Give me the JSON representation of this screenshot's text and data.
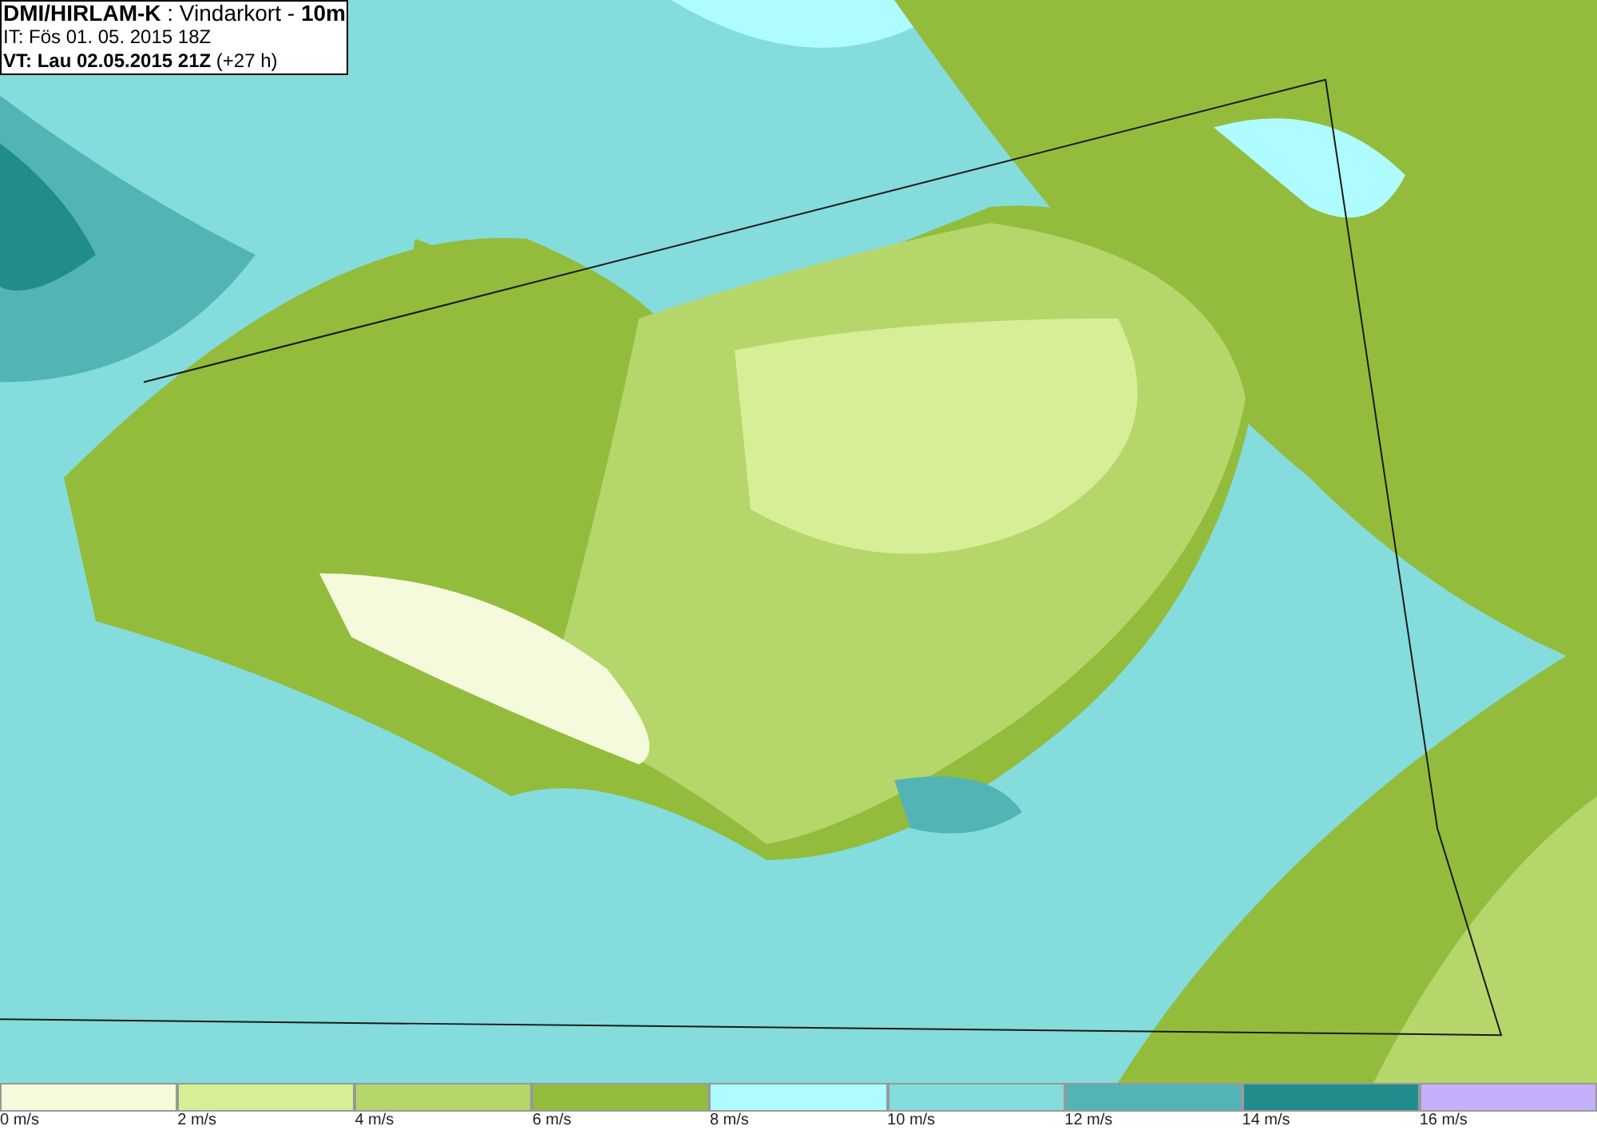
{
  "header": {
    "lines": [
      "**DMI/HIRLAM-K** : Vindarkort - **10m**",
      "IT: Fös 01. 05. 2015 18Z",
      "**VT: Lau 02.05.2015 21Z** (+27 h)"
    ]
  },
  "legend": {
    "bins": [
      {
        "label": "0 m/s",
        "color": "#f5fadc"
      },
      {
        "label": "2 m/s",
        "color": "#d6ef96"
      },
      {
        "label": "4 m/s",
        "color": "#b5d66a"
      },
      {
        "label": "6 m/s",
        "color": "#93bc3c"
      },
      {
        "label": "8 m/s",
        "color": "#aefcff"
      },
      {
        "label": "10 m/s",
        "color": "#84dcdc"
      },
      {
        "label": "12 m/s",
        "color": "#52b4b4"
      },
      {
        "label": "14 m/s",
        "color": "#218c8c"
      },
      {
        "label": "16 m/s",
        "color": "#c3b0f8"
      }
    ]
  }
}
